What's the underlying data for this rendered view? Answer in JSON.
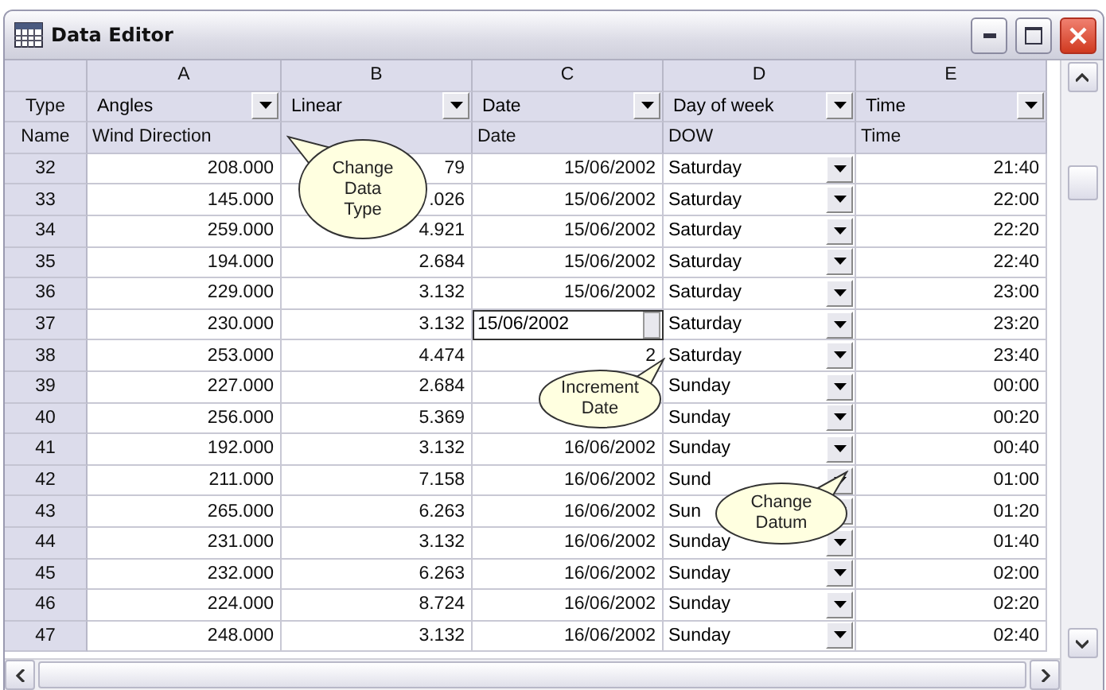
{
  "window": {
    "title": "Data Editor"
  },
  "columns": [
    {
      "letter": "A",
      "type": "Angles",
      "name": "Wind Direction",
      "kind": "number"
    },
    {
      "letter": "B",
      "type": "Linear",
      "kind": "number"
    },
    {
      "letter": "C",
      "type": "Date",
      "name": "Date",
      "kind": "date"
    },
    {
      "letter": "D",
      "type": "Day of week",
      "name": "DOW",
      "kind": "choice"
    },
    {
      "letter": "E",
      "type": "Time",
      "name": "Time",
      "kind": "time"
    }
  ],
  "header_labels": {
    "type": "Type",
    "name": "Name"
  },
  "rows": [
    {
      "num": "32",
      "cells": [
        "208.000",
        "79",
        "15/06/2002",
        "Saturday",
        "21:40"
      ],
      "editing": false
    },
    {
      "num": "33",
      "cells": [
        "145.000",
        ".026",
        "15/06/2002",
        "Saturday",
        "22:00"
      ],
      "editing": false
    },
    {
      "num": "34",
      "cells": [
        "259.000",
        "4.921",
        "15/06/2002",
        "Saturday",
        "22:20"
      ],
      "editing": false
    },
    {
      "num": "35",
      "cells": [
        "194.000",
        "2.684",
        "15/06/2002",
        "Saturday",
        "22:40"
      ],
      "editing": false
    },
    {
      "num": "36",
      "cells": [
        "229.000",
        "3.132",
        "15/06/2002",
        "Saturday",
        "23:00"
      ],
      "editing": false
    },
    {
      "num": "37",
      "cells": [
        "230.000",
        "3.132",
        "15/06/2002",
        "Saturday",
        "23:20"
      ],
      "editing": true
    },
    {
      "num": "38",
      "cells": [
        "253.000",
        "4.474",
        "2",
        "Saturday",
        "23:40"
      ],
      "editing": false
    },
    {
      "num": "39",
      "cells": [
        "227.000",
        "2.684",
        null,
        "Sunday",
        "00:00"
      ],
      "editing": false
    },
    {
      "num": "40",
      "cells": [
        "256.000",
        "5.369",
        null,
        "Sunday",
        "00:20"
      ],
      "editing": false
    },
    {
      "num": "41",
      "cells": [
        "192.000",
        "3.132",
        "16/06/2002",
        "Sunday",
        "00:40"
      ],
      "editing": false
    },
    {
      "num": "42",
      "cells": [
        "211.000",
        "7.158",
        "16/06/2002",
        "Sund",
        "01:00"
      ],
      "editing": false
    },
    {
      "num": "43",
      "cells": [
        "265.000",
        "6.263",
        "16/06/2002",
        "Sun",
        "01:20"
      ],
      "editing": false
    },
    {
      "num": "44",
      "cells": [
        "231.000",
        "3.132",
        "16/06/2002",
        "Sunday",
        "01:40"
      ],
      "editing": false
    },
    {
      "num": "45",
      "cells": [
        "232.000",
        "6.263",
        "16/06/2002",
        "Sunday",
        "02:00"
      ],
      "editing": false
    },
    {
      "num": "46",
      "cells": [
        "224.000",
        "8.724",
        "16/06/2002",
        "Sunday",
        "02:20"
      ],
      "editing": false
    },
    {
      "num": "47",
      "cells": [
        "248.000",
        "3.132",
        "16/06/2002",
        "Sunday",
        "02:40"
      ],
      "editing": false
    }
  ],
  "callouts": [
    {
      "lines": [
        "Change",
        "Data",
        "Type"
      ]
    },
    {
      "lines": [
        "Increment",
        "Date"
      ]
    },
    {
      "lines": [
        "Change",
        "Datum"
      ]
    }
  ]
}
